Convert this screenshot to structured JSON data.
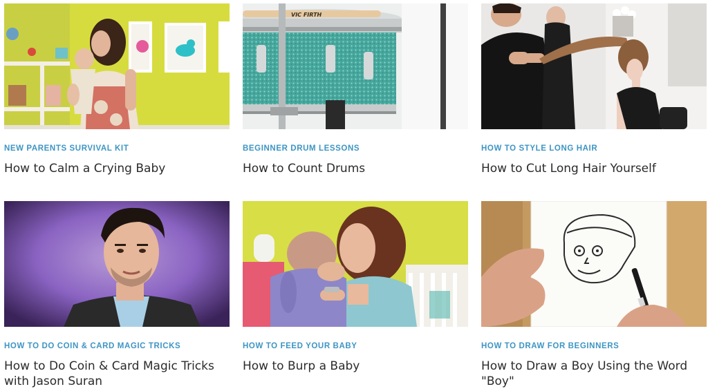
{
  "cards": [
    {
      "category": "NEW PARENTS SURVIVAL KIT",
      "title": "How to Calm a Crying Baby"
    },
    {
      "category": "BEGINNER DRUM LESSONS",
      "title": "How to Count Drums"
    },
    {
      "category": "HOW TO STYLE LONG HAIR",
      "title": "How to Cut Long Hair Yourself"
    },
    {
      "category": "HOW TO DO COIN & CARD MAGIC TRICKS",
      "title": "How to Do Coin & Card Magic Tricks with Jason Suran"
    },
    {
      "category": "HOW TO FEED YOUR BABY",
      "title": "How to Burp a Baby"
    },
    {
      "category": "HOW TO DRAW FOR BEGINNERS",
      "title": "How to Draw a Boy Using the Word \"Boy\""
    }
  ],
  "drum_brand_text": "VIC FIRTH"
}
